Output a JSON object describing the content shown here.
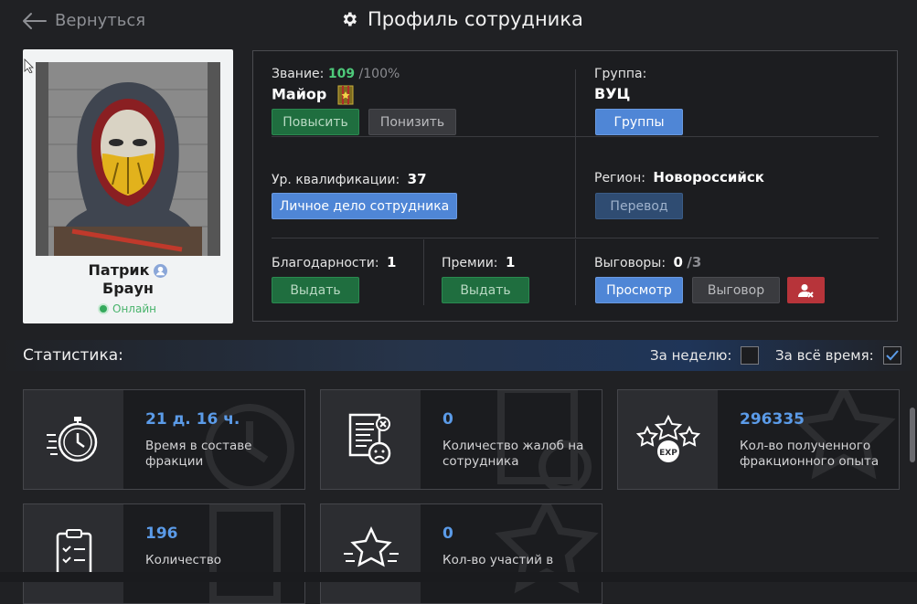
{
  "header": {
    "back_label": "Вернуться",
    "title": "Профиль сотрудника"
  },
  "profile": {
    "first_name": "Патрик",
    "last_name": "Браун",
    "status": "Онлайн"
  },
  "rank": {
    "label": "Звание:",
    "progress": "109",
    "progress_max": "/100%",
    "name": "Майор",
    "promote_label": "Повысить",
    "demote_label": "Понизить"
  },
  "group": {
    "label": "Группа:",
    "value": "ВУЦ",
    "button_label": "Группы"
  },
  "qualification": {
    "label": "Ур. квалификации:",
    "value": "37",
    "button_label": "Личное дело сотрудника"
  },
  "region": {
    "label": "Регион:",
    "value": "Новороссийск",
    "button_label": "Перевод"
  },
  "thanks": {
    "label": "Благодарности:",
    "value": "1",
    "button_label": "Выдать"
  },
  "bonuses": {
    "label": "Премии:",
    "value": "1",
    "button_label": "Выдать"
  },
  "reprimands": {
    "label": "Выговоры:",
    "value": "0",
    "max": "/3",
    "view_label": "Просмотр",
    "give_label": "Выговор"
  },
  "statistics": {
    "title": "Статистика:",
    "week_label": "За неделю:",
    "week_checked": false,
    "all_time_label": "За всё время:",
    "all_time_checked": true
  },
  "stats_cards": [
    {
      "icon": "stopwatch-icon",
      "value": "21 д. 16 ч.",
      "desc": "Время в составе фракции"
    },
    {
      "icon": "complaint-icon",
      "value": "0",
      "desc": "Количество жалоб на сотрудника"
    },
    {
      "icon": "exp-stars-icon",
      "value": "296335",
      "desc": "Кол-во полученного фракционного опыта"
    },
    {
      "icon": "clipboard-icon",
      "value": "196",
      "desc": "Количество"
    },
    {
      "icon": "star-icon",
      "value": "0",
      "desc": "Кол-во участий в"
    }
  ],
  "colors": {
    "accent_blue": "#4f86d6",
    "stat_value": "#5b9be8",
    "success_green": "#1f6e3f",
    "danger_red": "#b7343a",
    "online_green": "#35a95c"
  }
}
